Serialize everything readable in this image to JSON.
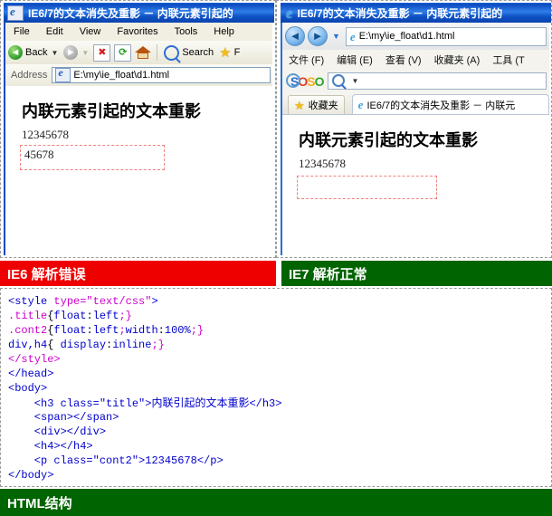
{
  "ie6": {
    "title": "IE6/7的文本消失及重影 － 内联元素引起的",
    "title_icon": "ie-document-icon",
    "menus": [
      "File",
      "Edit",
      "View",
      "Favorites",
      "Tools",
      "Help"
    ],
    "toolbar": {
      "back_label": "Back",
      "forward_label": "",
      "stop_glyph": "✖",
      "refresh_glyph": "⟳",
      "home_name": "home-icon",
      "search_label": "Search",
      "favorites_label": "F"
    },
    "address": {
      "label": "Address",
      "value": "E:\\my\\ie_float\\d1.html"
    },
    "page": {
      "heading": "内联元素引起的文本重影",
      "number": "12345678",
      "box_text": "45678"
    },
    "status_label": "IE6 解析错误",
    "status_color": "#ee0000"
  },
  "ie7": {
    "title": "IE6/7的文本消失及重影 － 内联元素引起的",
    "nav": {
      "back_glyph": "◄",
      "forward_glyph": "►",
      "recent_glyph": "▼"
    },
    "address": {
      "value": "E:\\my\\ie_float\\d1.html"
    },
    "menus": [
      "文件 (F)",
      "编辑 (E)",
      "查看 (V)",
      "收藏夹 (A)",
      "工具 (T"
    ],
    "search": {
      "brand": [
        "S",
        "O",
        "S",
        "O"
      ],
      "brand_colors": [
        "#2a6fd4",
        "#e03b2b",
        "#f2b01e",
        "#2fa52f"
      ],
      "placeholder": "",
      "value": ""
    },
    "favorites_label": "收藏夹",
    "tab_label": "IE6/7的文本消失及重影 － 内联元",
    "page": {
      "heading": "内联元素引起的文本重影",
      "number": "12345678",
      "box_text": ""
    },
    "status_label": "IE7 解析正常",
    "status_color": "#006400"
  },
  "code": {
    "label": "HTML结构",
    "label_color": "#006400",
    "lines": [
      [
        {
          "t": "<style ",
          "c": "tag"
        },
        {
          "t": "type=\"text/css\"",
          "c": "sel"
        },
        {
          "t": ">",
          "c": "tag"
        }
      ],
      [
        {
          "t": ".title",
          "c": "sel"
        },
        {
          "t": "{",
          "c": "cn"
        },
        {
          "t": "float",
          "c": "tag"
        },
        {
          "t": ":",
          "c": "cn"
        },
        {
          "t": "left",
          "c": "tag"
        },
        {
          "t": ";}",
          "c": "sel"
        }
      ],
      [
        {
          "t": ".cont2",
          "c": "sel"
        },
        {
          "t": "{",
          "c": "cn"
        },
        {
          "t": "float",
          "c": "tag"
        },
        {
          "t": ":",
          "c": "cn"
        },
        {
          "t": "left",
          "c": "tag"
        },
        {
          "t": ";",
          "c": "sel"
        },
        {
          "t": "width",
          "c": "tag"
        },
        {
          "t": ":",
          "c": "cn"
        },
        {
          "t": "100%",
          "c": "tag"
        },
        {
          "t": ";}",
          "c": "sel"
        }
      ],
      [
        {
          "t": "div,h4",
          "c": "tag"
        },
        {
          "t": "{ ",
          "c": "cn"
        },
        {
          "t": "display",
          "c": "tag"
        },
        {
          "t": ":",
          "c": "cn"
        },
        {
          "t": "inline",
          "c": "tag"
        },
        {
          "t": ";}",
          "c": "sel"
        }
      ],
      [
        {
          "t": "</style>",
          "c": "sel"
        }
      ],
      [
        {
          "t": "</head>",
          "c": "tag"
        }
      ],
      [
        {
          "t": "<body>",
          "c": "tag"
        }
      ],
      [
        {
          "t": "    <h3 ",
          "c": "tag"
        },
        {
          "t": "class=\"title\"",
          "c": "tag"
        },
        {
          "t": ">",
          "c": "tag"
        },
        {
          "t": "内联引起的文本重影",
          "c": "zh"
        },
        {
          "t": "</h3>",
          "c": "tag"
        }
      ],
      [
        {
          "t": "    <span></span>",
          "c": "tag"
        }
      ],
      [
        {
          "t": "    <div></div>",
          "c": "tag"
        }
      ],
      [
        {
          "t": "    <h4></h4>",
          "c": "tag"
        }
      ],
      [
        {
          "t": "    <p ",
          "c": "tag"
        },
        {
          "t": "class=\"cont2\"",
          "c": "tag"
        },
        {
          "t": ">",
          "c": "tag"
        },
        {
          "t": "12345678",
          "c": "tag"
        },
        {
          "t": "</p>",
          "c": "tag"
        }
      ],
      [
        {
          "t": "</body>",
          "c": "tag"
        }
      ]
    ]
  }
}
